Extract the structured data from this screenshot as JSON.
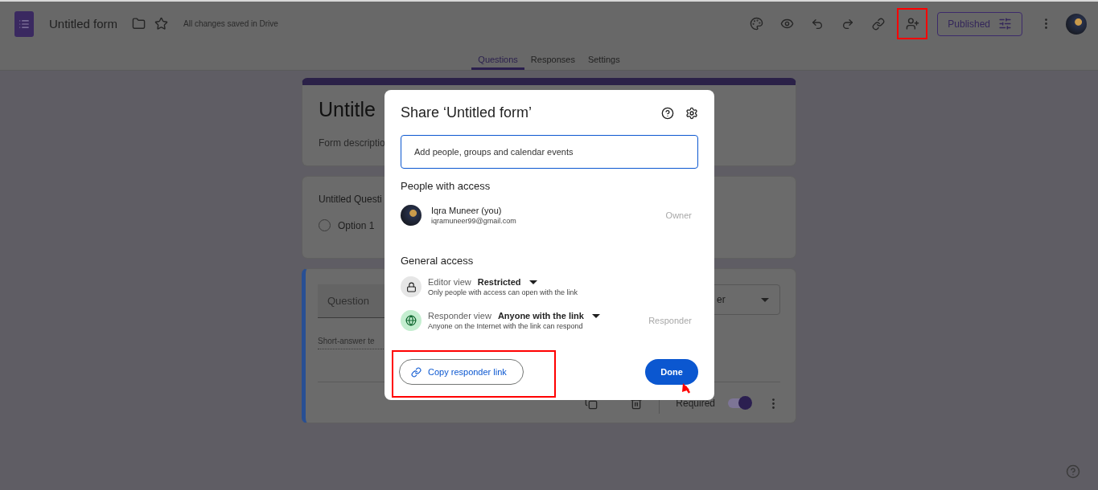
{
  "header": {
    "title": "Untitled form",
    "save_status": "All changes saved in Drive",
    "publish_button": "Published"
  },
  "tabs": [
    {
      "label": "Questions",
      "selected": true
    },
    {
      "label": "Responses",
      "selected": false
    },
    {
      "label": "Settings",
      "selected": false
    }
  ],
  "form": {
    "title": "Untitle",
    "description": "Form descriptio",
    "question_card": {
      "title": "Untitled Questi",
      "option": "Option 1",
      "option_selected": false
    },
    "active_card": {
      "question": "Question",
      "type_dropdown": "er",
      "answer_hint": "Short-answer te",
      "required_label": "Required",
      "required_on": true
    }
  },
  "dialog": {
    "title": "Share ‘Untitled form’",
    "search": {
      "placeholder": "Add people, groups and calendar events"
    },
    "people_heading": "People with access",
    "people": [
      {
        "name": "Iqra Muneer (you)",
        "email": "iqramuneer99@gmail.com",
        "role": "Owner"
      }
    ],
    "general_heading": "General access",
    "access": [
      {
        "kind": "lock",
        "label": "Editor view",
        "value": "Restricted",
        "description": "Only people with access can open with the link"
      },
      {
        "kind": "globe",
        "label": "Responder view",
        "value": "Anyone with the link",
        "description": "Anyone on the Internet with the link can respond",
        "role": "Responder"
      }
    ],
    "copy_button": "Copy responder link",
    "done_button": "Done"
  }
}
